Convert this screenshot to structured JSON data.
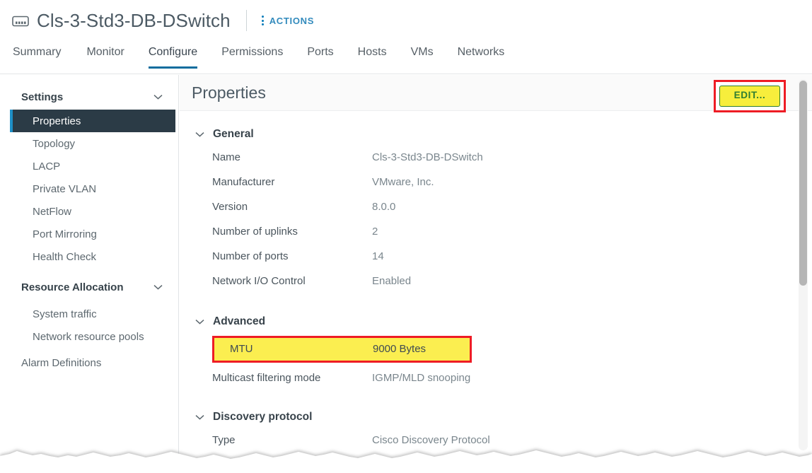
{
  "header": {
    "icon": "distributed-switch-icon",
    "object_title": "Cls-3-Std3-DB-DSwitch",
    "actions_label": "ACTIONS",
    "actions_icon": "kebab-menu-icon"
  },
  "tabs": [
    {
      "label": "Summary",
      "active": false
    },
    {
      "label": "Monitor",
      "active": false
    },
    {
      "label": "Configure",
      "active": true
    },
    {
      "label": "Permissions",
      "active": false
    },
    {
      "label": "Ports",
      "active": false
    },
    {
      "label": "Hosts",
      "active": false
    },
    {
      "label": "VMs",
      "active": false
    },
    {
      "label": "Networks",
      "active": false
    }
  ],
  "sidebar": {
    "groups": [
      {
        "label": "Settings",
        "expanded": true,
        "chevron": "chevron-down-icon",
        "items": [
          {
            "label": "Properties",
            "selected": true
          },
          {
            "label": "Topology",
            "selected": false
          },
          {
            "label": "LACP",
            "selected": false
          },
          {
            "label": "Private VLAN",
            "selected": false
          },
          {
            "label": "NetFlow",
            "selected": false
          },
          {
            "label": "Port Mirroring",
            "selected": false
          },
          {
            "label": "Health Check",
            "selected": false
          }
        ]
      },
      {
        "label": "Resource Allocation",
        "expanded": true,
        "chevron": "chevron-down-icon",
        "items": [
          {
            "label": "System traffic",
            "selected": false
          },
          {
            "label": "Network resource pools",
            "selected": false
          }
        ]
      }
    ],
    "standalone": [
      {
        "label": "Alarm Definitions",
        "selected": false
      }
    ]
  },
  "content": {
    "page_title": "Properties",
    "edit_button": {
      "label": "EDIT...",
      "highlighted": true,
      "fill_color": "#f7ee3c",
      "text_color": "#2e7d32",
      "highlight_border_color": "#ee1c25"
    },
    "sections": [
      {
        "title": "General",
        "chevron": "chevron-down-icon",
        "rows": [
          {
            "label": "Name",
            "value": "Cls-3-Std3-DB-DSwitch"
          },
          {
            "label": "Manufacturer",
            "value": "VMware, Inc."
          },
          {
            "label": "Version",
            "value": "8.0.0"
          },
          {
            "label": "Number of uplinks",
            "value": "2"
          },
          {
            "label": "Number of ports",
            "value": "14"
          },
          {
            "label": "Network I/O Control",
            "value": "Enabled"
          }
        ]
      },
      {
        "title": "Advanced",
        "chevron": "chevron-down-icon",
        "rows": [
          {
            "label": "MTU",
            "value": "9000 Bytes",
            "highlighted": true
          },
          {
            "label": "Multicast filtering mode",
            "value": "IGMP/MLD snooping"
          }
        ]
      },
      {
        "title": "Discovery protocol",
        "chevron": "chevron-down-icon",
        "rows": [
          {
            "label": "Type",
            "value": "Cisco Discovery Protocol"
          }
        ]
      }
    ]
  },
  "scrollbar": {
    "name": "content-scrollbar"
  },
  "highlight_colors": {
    "annotation_red": "#ee1c25",
    "annotation_yellow": "#fbee50",
    "accent_blue": "#0f6d9e",
    "selected_nav_bg": "#2b3b46"
  }
}
